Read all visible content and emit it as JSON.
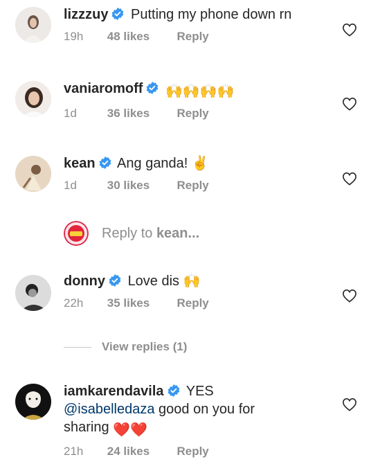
{
  "comments": [
    {
      "username": "lizzzuy",
      "text": "Putting my phone down rn",
      "time": "19h",
      "likes": "48 likes",
      "reply": "Reply",
      "avatar_color": "#e8e4e2"
    },
    {
      "username": "vaniaromoff",
      "text": "🙌🙌🙌🙌",
      "time": "1d",
      "likes": "36 likes",
      "reply": "Reply",
      "avatar_color": "#d8c7bd"
    },
    {
      "username": "kean",
      "text": "Ang ganda! ✌️",
      "time": "1d",
      "likes": "30 likes",
      "reply": "Reply",
      "avatar_color": "#cdb9a3"
    },
    {
      "username": "donny",
      "text": "Love dis 🙌",
      "time": "22h",
      "likes": "35 likes",
      "reply": "Reply",
      "avatar_color": "#5a5a5a"
    },
    {
      "username": "iamkarendavila",
      "text": "YES",
      "mention": "@isabelledaza",
      "text_cont": " good on you for",
      "text_line3": "sharing",
      "hearts": "❤️❤️",
      "time": "21h",
      "likes": "24 likes",
      "reply": "Reply",
      "avatar_color": "#1d1d1d"
    }
  ],
  "reply_input": {
    "placeholder": "Reply to",
    "target": "kean..."
  },
  "view_replies": "View replies (1)",
  "colors": {
    "verified": "#3897f0",
    "muted": "#8e8e8e",
    "text": "#262626",
    "mention": "#00376b"
  }
}
